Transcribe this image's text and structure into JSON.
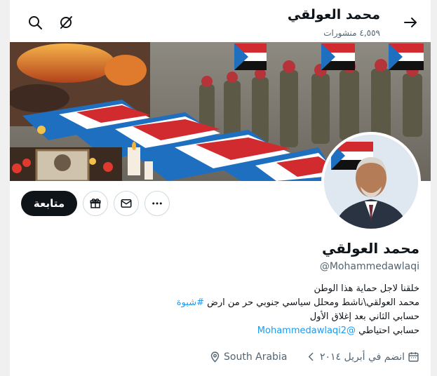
{
  "header": {
    "title": "محمد العولقي",
    "posts_count": "٤,٥٥٩ منشورات"
  },
  "actions": {
    "follow_label": "متابعة"
  },
  "profile": {
    "name": "محمد العولقي",
    "handle": "@Mohammedawlaqi",
    "bio": {
      "line1": "خلقنا لاجل حماية هذا الوطن",
      "line2_text": "محمد العولقي\\ناشط ومحلل سياسي جنوبي حر من ارض ",
      "line2_hashtag": "#شبوة",
      "line3": "حسابي الثاني بعد إغلاق الأول",
      "line4_text": "حسابي احتياطي ",
      "line4_mention": "@Mohammedawlaqi2"
    },
    "location": "South Arabia",
    "joined": "انضم في أبريل ٢٠١٤"
  },
  "icons": {
    "back": "back-arrow-icon",
    "search": "search-icon",
    "grok": "grok-icon",
    "gift": "gift-icon",
    "mail": "mail-icon",
    "more": "more-icon",
    "location": "location-pin-icon",
    "calendar": "calendar-icon",
    "chevron": "chevron-left-icon"
  },
  "colors": {
    "link": "#1d9bf0",
    "secondary_text": "#536471",
    "follow_bg": "#0f1419"
  }
}
